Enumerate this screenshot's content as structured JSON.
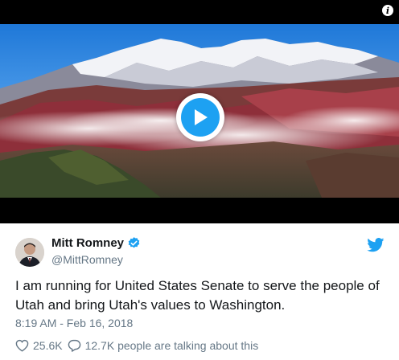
{
  "media": {
    "type": "video",
    "info_icon": "info-icon",
    "play_icon": "play-icon"
  },
  "tweet": {
    "author_name": "Mitt Romney",
    "handle": "@MittRomney",
    "verified": true,
    "text": "I am running for United States Senate to serve the people of Utah and bring Utah's values to Washington.",
    "timestamp": "8:19 AM - Feb 16, 2018",
    "likes": "25.6K",
    "replies_summary": "12.7K people are talking about this"
  },
  "colors": {
    "accent": "#1da1f2",
    "text": "#14171a",
    "muted": "#657786"
  }
}
